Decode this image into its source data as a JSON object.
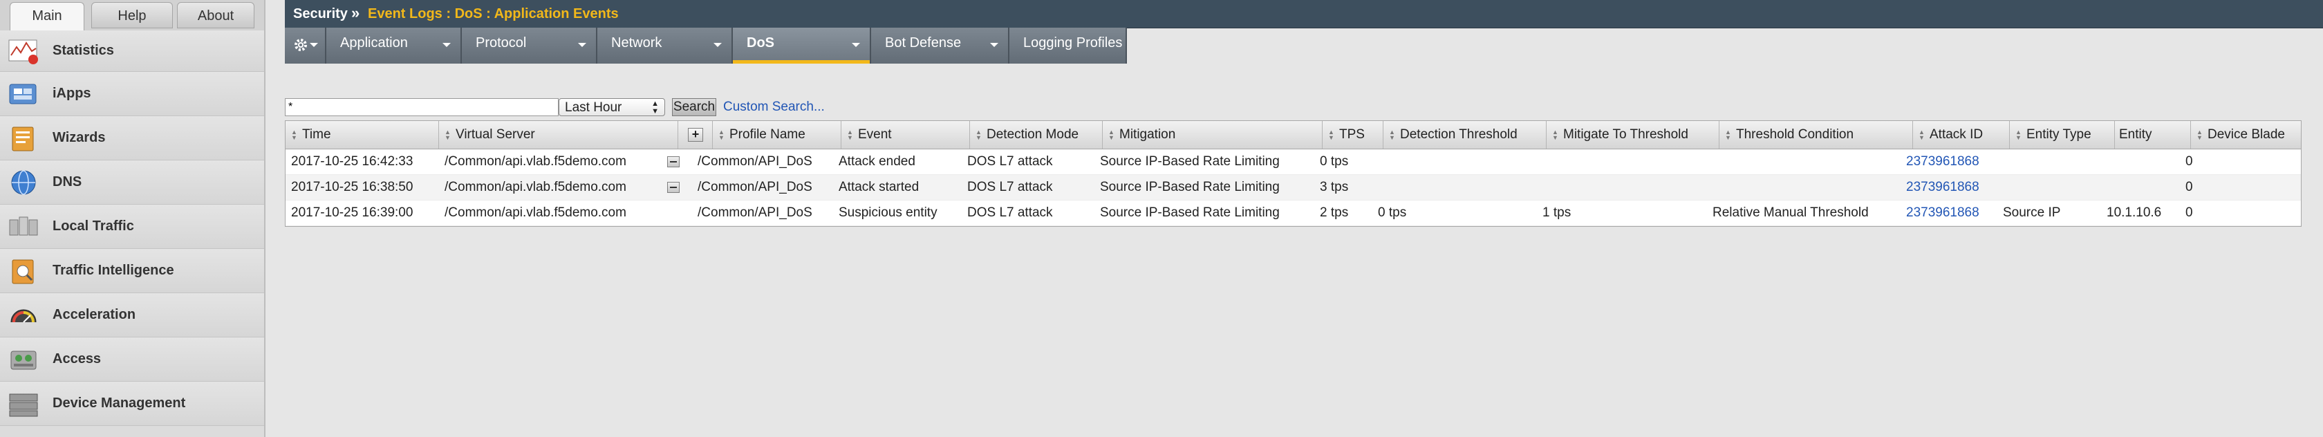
{
  "nav_tabs": [
    {
      "label": "Main",
      "active": true
    },
    {
      "label": "Help",
      "active": false
    },
    {
      "label": "About",
      "active": false
    }
  ],
  "nav_items": [
    {
      "label": "Statistics",
      "icon": "statistics-icon"
    },
    {
      "label": "iApps",
      "icon": "iapps-icon"
    },
    {
      "label": "Wizards",
      "icon": "wizards-icon"
    },
    {
      "label": "DNS",
      "icon": "dns-globe-icon"
    },
    {
      "label": "Local Traffic",
      "icon": "local-traffic-icon"
    },
    {
      "label": "Traffic Intelligence",
      "icon": "traffic-intelligence-icon"
    },
    {
      "label": "Acceleration",
      "icon": "acceleration-gauge-icon"
    },
    {
      "label": "Access",
      "icon": "access-icon"
    },
    {
      "label": "Device Management",
      "icon": "device-management-icon"
    }
  ],
  "breadcrumb": {
    "root": "Security",
    "separator": "»",
    "path": "Event Logs : DoS : Application Events"
  },
  "menubar": {
    "gear_icon": "gear-icon",
    "items": [
      {
        "label": "Application",
        "active": false
      },
      {
        "label": "Protocol",
        "active": false
      },
      {
        "label": "Network",
        "active": false
      },
      {
        "label": "DoS",
        "active": true
      },
      {
        "label": "Bot Defense",
        "active": false
      },
      {
        "label": "Logging Profiles",
        "active": false
      }
    ]
  },
  "search": {
    "value": "*",
    "period": "Last Hour",
    "button": "Search",
    "custom_link": "Custom Search..."
  },
  "table": {
    "columns": [
      "Time",
      "Virtual Server",
      "",
      "Profile Name",
      "Event",
      "Detection Mode",
      "Mitigation",
      "TPS",
      "Detection Threshold",
      "Mitigate To Threshold",
      "Threshold Condition",
      "Attack ID",
      "Entity Type",
      "Entity",
      "Device Blade"
    ],
    "rows": [
      [
        "2017-10-25 16:42:33",
        "/Common/api.vlab.f5demo.com",
        "-",
        "/Common/API_DoS",
        "Attack ended",
        "DOS L7 attack",
        "Source IP-Based Rate Limiting",
        "0 tps",
        "",
        "",
        "",
        "2373961868",
        "",
        "",
        "0"
      ],
      [
        "2017-10-25 16:38:50",
        "/Common/api.vlab.f5demo.com",
        "-",
        "/Common/API_DoS",
        "Attack started",
        "DOS L7 attack",
        "Source IP-Based Rate Limiting",
        "3 tps",
        "",
        "",
        "",
        "2373961868",
        "",
        "",
        "0"
      ],
      [
        "2017-10-25 16:39:00",
        "/Common/api.vlab.f5demo.com",
        "",
        "/Common/API_DoS",
        "Suspicious entity",
        "DOS L7 attack",
        "Source IP-Based Rate Limiting",
        "2 tps",
        "0 tps",
        "1 tps",
        "Relative Manual Threshold",
        "2373961868",
        "Source IP",
        "10.1.10.6",
        "0"
      ]
    ]
  },
  "colors": {
    "title_bg": "#3d4f5e",
    "breadcrumb_accent": "#f2b81a",
    "menu_bg": "#6f7983",
    "link": "#2256b5"
  }
}
